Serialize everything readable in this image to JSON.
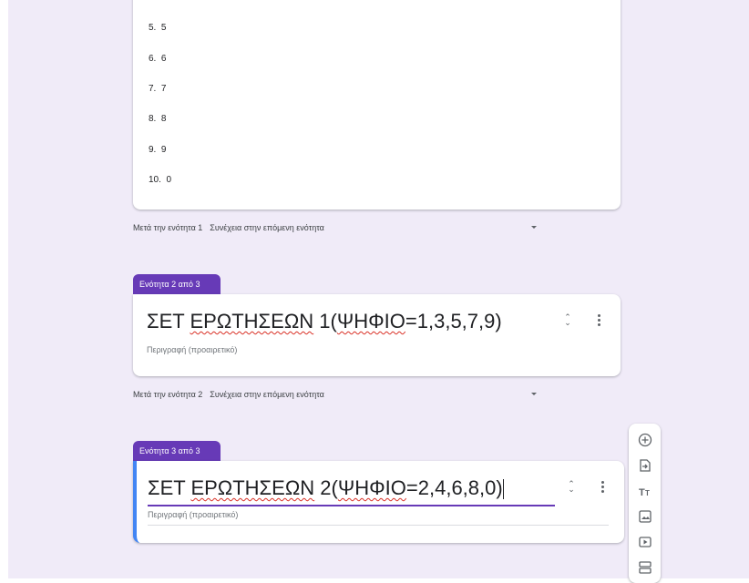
{
  "options": [
    {
      "num": "5.",
      "label": "5"
    },
    {
      "num": "6.",
      "label": "6"
    },
    {
      "num": "7.",
      "label": "7"
    },
    {
      "num": "8.",
      "label": "8"
    },
    {
      "num": "9.",
      "label": "9"
    },
    {
      "num": "10.",
      "label": "0"
    }
  ],
  "after_section_1": {
    "label": "Μετά την ενότητα 1",
    "action": "Συνέχεια στην επόμενη ενότητα"
  },
  "section_2": {
    "badge": "Ενότητα 2 από 3",
    "title_part1": "ΣΕΤ ",
    "title_part2": "ΕΡΩΤΗΣΕΩΝ",
    "title_part3": " 1(",
    "title_part4": "ΨΗΦΙΟ",
    "title_part5": "=1,3,5,7,9)",
    "description_placeholder": "Περιγραφή (προαιρετικό)"
  },
  "after_section_2": {
    "label": "Μετά την ενότητα 2",
    "action": "Συνέχεια στην επόμενη ενότητα"
  },
  "section_3": {
    "badge": "Ενότητα 3 από 3",
    "title_part1": "ΣΕΤ ",
    "title_part2": "ΕΡΩΤΗΣΕΩΝ",
    "title_part3": " 2(",
    "title_part4": "ΨΗΦΙΟ",
    "title_part5": "=2,4,6,8,0)",
    "description_placeholder": "Περιγραφή (προαιρετικό)"
  },
  "toolbar": {
    "items": [
      "add-question-icon",
      "import-questions-icon",
      "add-title-icon",
      "add-image-icon",
      "add-video-icon",
      "add-section-icon"
    ]
  },
  "colors": {
    "accent": "#673ab7",
    "active_border": "#4285f4",
    "background": "#f0ebf8"
  }
}
